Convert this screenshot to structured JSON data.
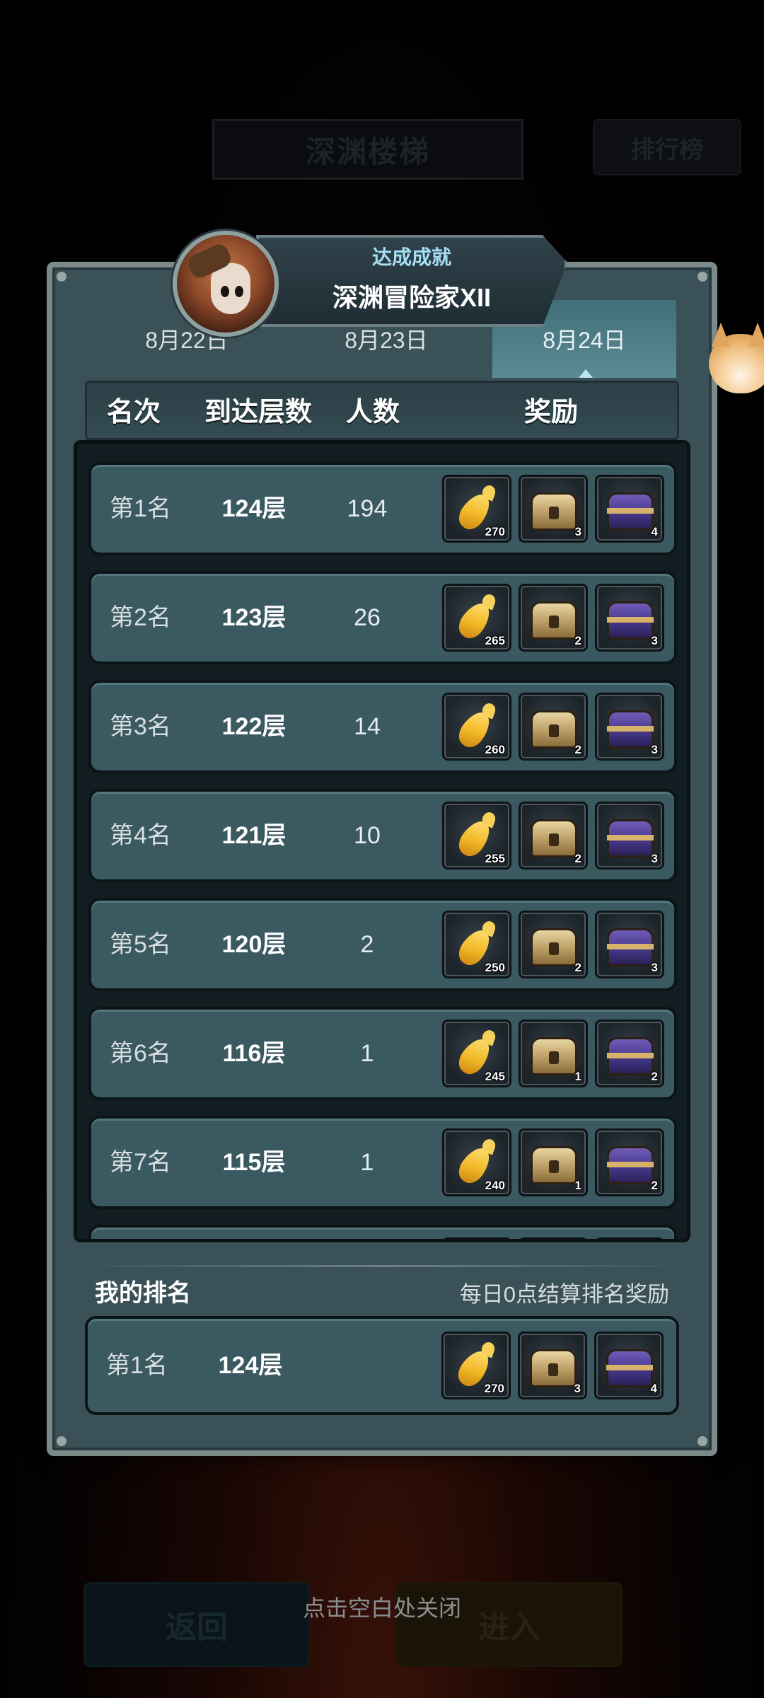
{
  "background": {
    "title": "深渊楼梯",
    "rank_button": "排行榜",
    "back_button": "返回",
    "enter_button": "进入",
    "close_hint": "点击空白处关闭"
  },
  "achievement": {
    "subtitle": "达成成就",
    "title": "深渊冒险家XII"
  },
  "tabs": [
    {
      "label": "8月22日",
      "active": false
    },
    {
      "label": "8月23日",
      "active": false
    },
    {
      "label": "8月24日",
      "active": true
    }
  ],
  "columns": {
    "rank": "名次",
    "floors": "到达层数",
    "count": "人数",
    "reward": "奖励"
  },
  "rows": [
    {
      "rank": "第1名",
      "floors": "124层",
      "count": "194",
      "rewards": [
        "270",
        "3",
        "4"
      ]
    },
    {
      "rank": "第2名",
      "floors": "123层",
      "count": "26",
      "rewards": [
        "265",
        "2",
        "3"
      ]
    },
    {
      "rank": "第3名",
      "floors": "122层",
      "count": "14",
      "rewards": [
        "260",
        "2",
        "3"
      ]
    },
    {
      "rank": "第4名",
      "floors": "121层",
      "count": "10",
      "rewards": [
        "255",
        "2",
        "3"
      ]
    },
    {
      "rank": "第5名",
      "floors": "120层",
      "count": "2",
      "rewards": [
        "250",
        "2",
        "3"
      ]
    },
    {
      "rank": "第6名",
      "floors": "116层",
      "count": "1",
      "rewards": [
        "245",
        "1",
        "2"
      ]
    },
    {
      "rank": "第7名",
      "floors": "115层",
      "count": "1",
      "rewards": [
        "240",
        "1",
        "2"
      ]
    }
  ],
  "my_rank": {
    "title": "我的排名",
    "hint": "每日0点结算排名奖励",
    "rank": "第1名",
    "floors": "124层",
    "rewards": [
      "270",
      "3",
      "4"
    ]
  },
  "reward_icons": [
    "golden-carrot-icon",
    "gold-chest-icon",
    "purple-chest-icon"
  ]
}
